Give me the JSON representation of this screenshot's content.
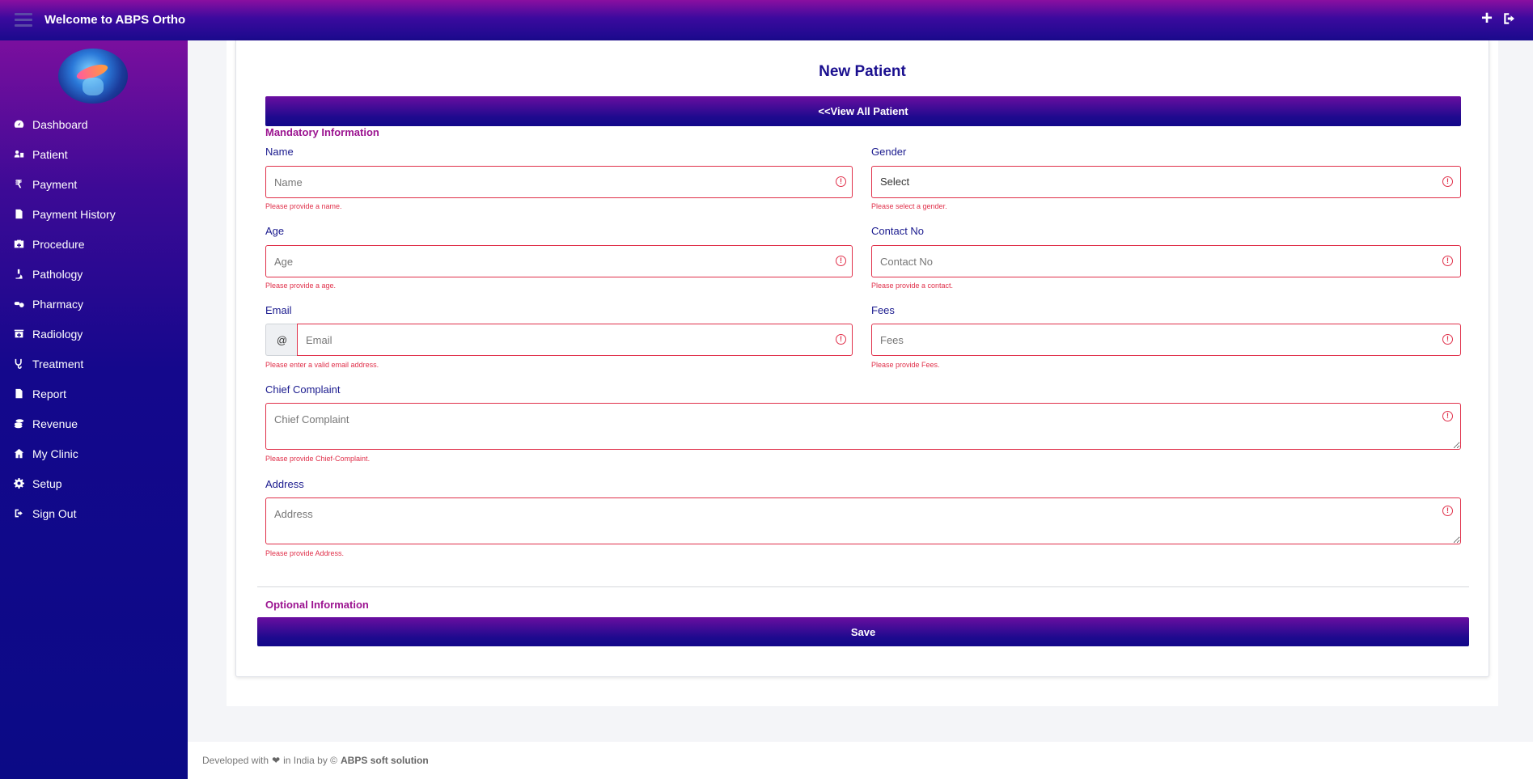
{
  "header": {
    "title": "Welcome to ABPS Ortho",
    "add_icon": "plus-icon",
    "signout_icon": "sign-out-icon"
  },
  "sidebar": {
    "items": [
      {
        "label": "Dashboard",
        "icon": "dashboard-icon"
      },
      {
        "label": "Patient",
        "icon": "patient-icon"
      },
      {
        "label": "Payment",
        "icon": "rupee-icon"
      },
      {
        "label": "Payment History",
        "icon": "file-icon"
      },
      {
        "label": "Procedure",
        "icon": "medkit-icon"
      },
      {
        "label": "Pathology",
        "icon": "microscope-icon"
      },
      {
        "label": "Pharmacy",
        "icon": "pills-icon"
      },
      {
        "label": "Radiology",
        "icon": "clinic-icon"
      },
      {
        "label": "Treatment",
        "icon": "stethoscope-icon"
      },
      {
        "label": "Report",
        "icon": "file-icon"
      },
      {
        "label": "Revenue",
        "icon": "coins-icon"
      },
      {
        "label": "My Clinic",
        "icon": "home-icon"
      },
      {
        "label": "Setup",
        "icon": "gear-icon"
      },
      {
        "label": "Sign Out",
        "icon": "sign-out-icon"
      }
    ]
  },
  "form": {
    "title": "New Patient",
    "view_all_label": "<<View All Patient",
    "mandatory_title": "Mandatory Information",
    "optional_title": "Optional Information",
    "save_label": "Save",
    "fields": {
      "name": {
        "label": "Name",
        "placeholder": "Name",
        "error": "Please provide a name."
      },
      "gender": {
        "label": "Gender",
        "value": "Select",
        "error": "Please select a gender."
      },
      "age": {
        "label": "Age",
        "placeholder": "Age",
        "error": "Please provide a age."
      },
      "contact": {
        "label": "Contact No",
        "placeholder": "Contact No",
        "error": "Please provide a contact."
      },
      "email": {
        "label": "Email",
        "prefix": "@",
        "placeholder": "Email",
        "error": "Please enter a valid email address."
      },
      "fees": {
        "label": "Fees",
        "placeholder": "Fees",
        "error": "Please provide Fees."
      },
      "complaint": {
        "label": "Chief Complaint",
        "placeholder": "Chief Complaint",
        "error": "Please provide Chief-Complaint."
      },
      "address": {
        "label": "Address",
        "placeholder": "Address",
        "error": "Please provide Address."
      }
    }
  },
  "footer": {
    "prefix": "Developed with",
    "heart": "❤",
    "middle": "in India by ©",
    "company": "ABPS soft solution"
  },
  "colors": {
    "accent": "#1a0f8f",
    "error": "#e0304a",
    "section": "#9b1390"
  }
}
